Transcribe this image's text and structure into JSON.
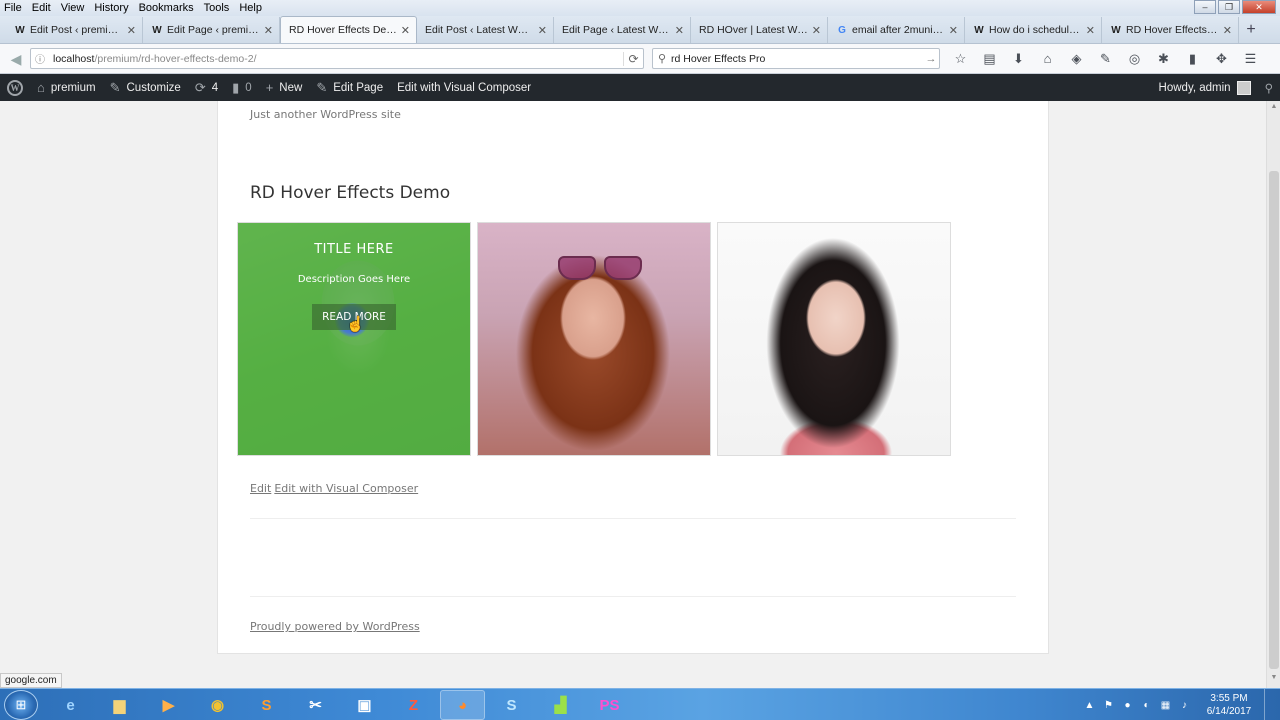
{
  "menubar": [
    "File",
    "Edit",
    "View",
    "History",
    "Bookmarks",
    "Tools",
    "Help"
  ],
  "tabs": [
    {
      "title": "Edit Post ‹ premium — ...",
      "favicon": "W",
      "active": false
    },
    {
      "title": "Edit Page ‹ premium —...",
      "favicon": "W",
      "active": false
    },
    {
      "title": "RD Hover Effects Demo...",
      "favicon": "",
      "active": true
    },
    {
      "title": "Edit Post ‹ Latest Word...",
      "favicon": "W",
      "active": false
    },
    {
      "title": "Edit Page ‹ Latest Word...",
      "favicon": "W",
      "active": false
    },
    {
      "title": "RD HOver | Latest Word...",
      "favicon": "",
      "active": false
    },
    {
      "title": "email after 2munite...",
      "favicon": "G",
      "active": false
    },
    {
      "title": "How do i schedule ...",
      "favicon": "W",
      "active": false
    },
    {
      "title": "RD Hover Effects: T...",
      "favicon": "W",
      "active": false
    }
  ],
  "nav": {
    "url_host": "localhost",
    "url_path": "/premium/rd-hover-effects-demo-2/",
    "search_value": "rd Hover Effects Pro"
  },
  "wpbar": {
    "site_name": "premium",
    "customize": "Customize",
    "updates_count": "4",
    "comments_count": "0",
    "new_label": "New",
    "edit_page": "Edit Page",
    "edit_vc": "Edit with Visual Composer",
    "howdy": "Howdy, admin"
  },
  "page": {
    "tagline": "Just another WordPress site",
    "title": "RD Hover Effects Demo",
    "overlay_title": "TITLE HERE",
    "overlay_desc": "Description Goes Here",
    "overlay_button": "READ MORE",
    "edit_link": "Edit",
    "edit_vc_link": "Edit with Visual Composer",
    "footer": "Proudly powered by WordPress"
  },
  "status_url": "google.com",
  "taskbar": {
    "time": "3:55 PM",
    "date": "6/14/2017"
  },
  "colors": {
    "overlay_green": "#4caf3c",
    "admin_bar": "#23282d",
    "taskbar": "#3f8ad6"
  }
}
